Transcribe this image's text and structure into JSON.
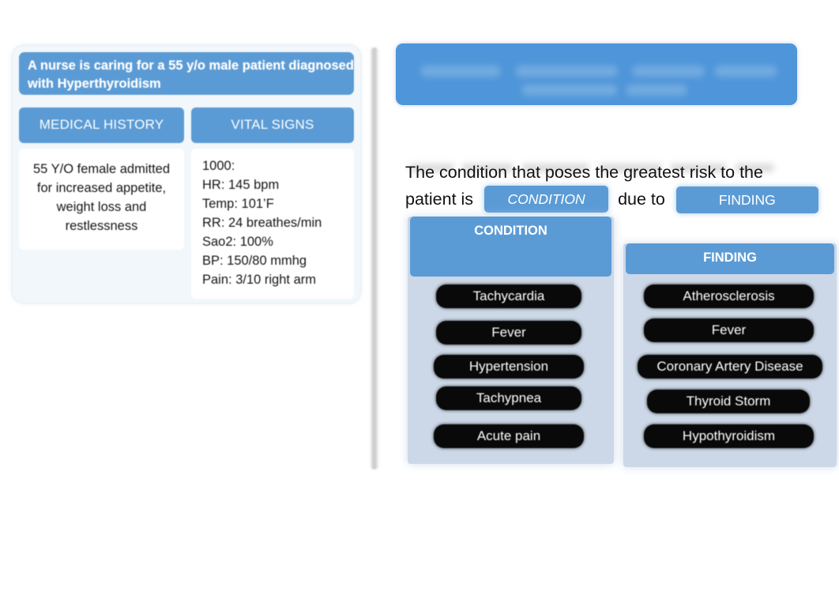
{
  "case_panel": {
    "title": "A nurse is caring for a  55 y/o male patient diagnosed with Hyperthyroidism",
    "columns": [
      {
        "header": "MEDICAL HISTORY",
        "body": "55 Y/O female admitted for increased appetite, weight loss and restlessness"
      },
      {
        "header": "VITAL SIGNS",
        "lines": [
          "1000:",
          "HR: 145 bpm",
          "Temp: 101’F",
          "RR: 24 breathes/min",
          "Sao2: 100%",
          "BP: 150/80 mmhg",
          "Pain: 3/10 right arm"
        ]
      }
    ]
  },
  "question_panel": {
    "header_text": "",
    "subline_text": "",
    "sentence_line1": "The condition that poses the greatest risk to the",
    "sentence_part_a": "patient is",
    "blank_condition_label": "CONDITION",
    "sentence_part_b": "due to",
    "blank_finding_label": "FINDING",
    "dropdowns": [
      {
        "header": "CONDITION",
        "options": [
          "Tachycardia",
          "Fever",
          "Hypertension",
          "Tachypnea",
          "Acute pain"
        ]
      },
      {
        "header": "FINDING",
        "options": [
          "Atherosclerosis",
          "Fever",
          "Coronary Artery Disease",
          "Thyroid Storm",
          "Hypothyroidism"
        ]
      }
    ]
  },
  "colors": {
    "accent_blue": "#5b9bd5",
    "header_blue": "#4e95d9",
    "panel_light": "#ccd8e7",
    "option_black": "#090909",
    "case_panel_bg": "#f2f7fc",
    "text_dark": "#111111"
  }
}
